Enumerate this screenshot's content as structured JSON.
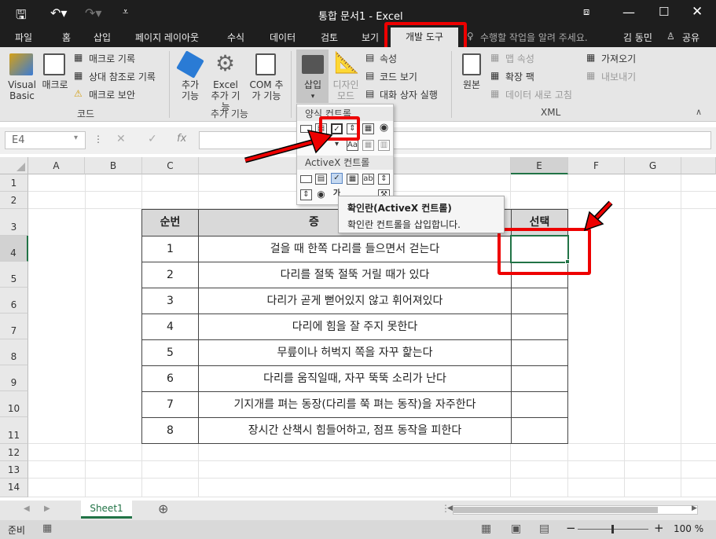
{
  "window": {
    "title": "통합 문서1 - Excel"
  },
  "tabs": [
    "파일",
    "홈",
    "삽입",
    "페이지 레이아웃",
    "수식",
    "데이터",
    "검토",
    "보기",
    "개발 도구"
  ],
  "tell_me": "수행할 작업을 알려 주세요.",
  "user": "김 동민",
  "share": "공유",
  "ribbon": {
    "visual_basic": "Visual Basic",
    "macro": "매크로",
    "record_macro": "매크로 기록",
    "relative_ref": "상대 참조로 기록",
    "macro_security": "매크로 보안",
    "group_code": "코드",
    "addins": "추가 기능",
    "excel_addins": "Excel 추가 기능",
    "com_addins": "COM 추가 기능",
    "group_addins": "추가 기능",
    "insert": "삽입",
    "design_mode": "디자인 모드",
    "properties": "속성",
    "view_code": "코드 보기",
    "run_dialog": "대화 상자 실행",
    "source": "원본",
    "map_properties": "맵 속성",
    "expansion_packs": "확장 팩",
    "refresh_data": "데이터 새로 고침",
    "import": "가져오기",
    "export": "내보내기",
    "group_xml": "XML"
  },
  "insert_menu": {
    "form_controls": "양식 컨트롤",
    "activex_controls": "ActiveX 컨트롤"
  },
  "tooltip": {
    "title": "확인란(ActiveX 컨트롤)",
    "desc": "확인란 컨트롤을 삽입합니다."
  },
  "formula_bar": {
    "name_box": "E4",
    "fx": "fx"
  },
  "columns": [
    "A",
    "B",
    "C",
    "D",
    "E",
    "F",
    "G"
  ],
  "rows": [
    "1",
    "2",
    "3",
    "4",
    "5",
    "6",
    "7",
    "8",
    "9",
    "10",
    "11",
    "12",
    "13",
    "14"
  ],
  "table": {
    "headers": [
      "순번",
      "증상",
      "선택"
    ],
    "header_partial": "증",
    "rows": [
      {
        "no": "1",
        "text": "걸을 때 한쪽 다리를 들으면서 걷는다"
      },
      {
        "no": "2",
        "text": "다리를 절뚝 절뚝 거릴 때가 있다"
      },
      {
        "no": "3",
        "text": "다리가 곧게 뻗어있지 않고 휘어져있다"
      },
      {
        "no": "4",
        "text": "다리에 힘을 잘 주지 못한다"
      },
      {
        "no": "5",
        "text": "무릎이나 허벅지 쪽을 자꾸 핥는다"
      },
      {
        "no": "6",
        "text": "다리를 움직일때, 자꾸 뚝뚝 소리가 난다"
      },
      {
        "no": "7",
        "text": "기지개를 펴는 동장(다리를 쭉 펴는 동작)을 자주한다"
      },
      {
        "no": "8",
        "text": "장시간 산책시 힘들어하고, 점프 동작을 피한다"
      }
    ]
  },
  "sheet_tab": "Sheet1",
  "status": {
    "ready": "준비",
    "zoom": "100 %"
  },
  "colors": {
    "accent_red": "#e00000",
    "excel_green": "#217346",
    "header_gray": "#d9d9d9"
  }
}
